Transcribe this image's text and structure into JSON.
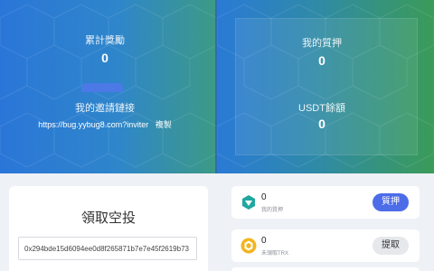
{
  "left_panel": {
    "cumulative_label": "累計獎勵",
    "cumulative_value": "0",
    "invite_label": "我的邀請鏈接",
    "invite_link": "https://bug.yybug8.com?inviter",
    "copy_label": "複製"
  },
  "right_panel": {
    "pledge_label": "我的質押",
    "pledge_value": "0",
    "usdt_label": "USDT餘額",
    "usdt_value": "0"
  },
  "airdrop": {
    "title": "領取空投",
    "address": "0x294bde15d6094ee0d8f265871b7e7e45f2619b73"
  },
  "rows": [
    {
      "value": "0",
      "sub": "我的質押",
      "button": "質押",
      "icon": "diamond-icon"
    },
    {
      "value": "0",
      "sub": "未領取TRX",
      "button": "提取",
      "icon": "coin-icon"
    }
  ],
  "colors": {
    "primary_button": "#4c6ce8",
    "header_blue": "#2a76d8",
    "header_green": "#3b9b58"
  }
}
